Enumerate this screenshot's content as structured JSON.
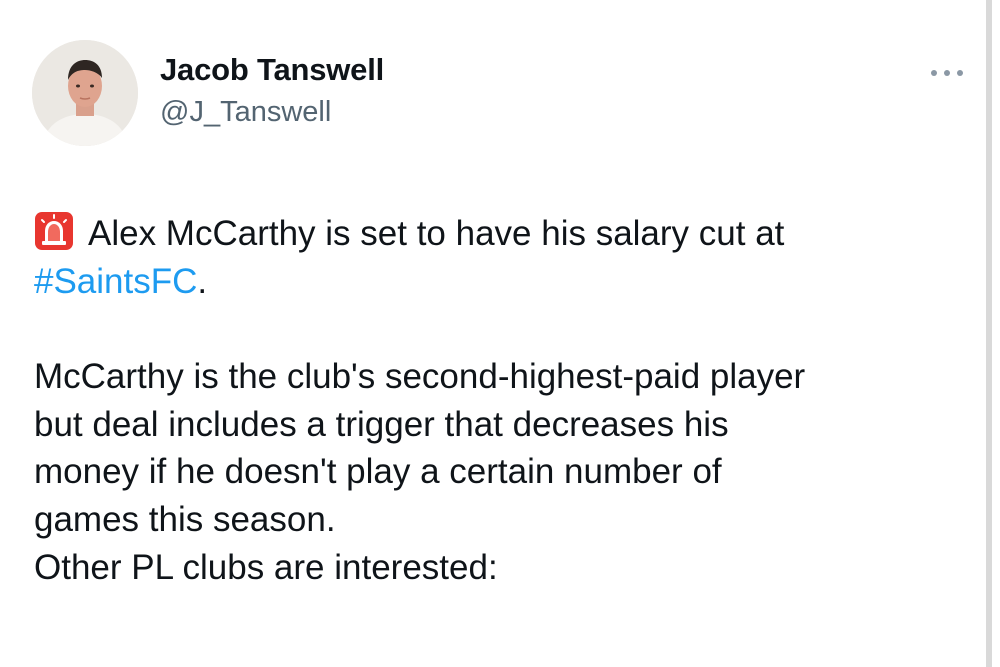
{
  "author": {
    "display_name": "Jacob Tanswell",
    "handle": "@J_Tanswell",
    "avatar_icon": "person-avatar"
  },
  "more_icon": "more-dots-icon",
  "tweet": {
    "alert_icon": "rotating-light-icon",
    "line1_text": "Alex McCarthy is set to have his salary cut at",
    "hashtag": "#SaintsFC",
    "line1_end": ".",
    "para2": [
      "McCarthy is the club's second-highest-paid player",
      "but deal includes a trigger that decreases his",
      "money if he doesn't play a certain number of",
      "games this season."
    ],
    "para3": "Other PL clubs are interested:"
  },
  "colors": {
    "text": "#0f1419",
    "secondary_text": "#536471",
    "link": "#1d9bf0",
    "alert_red": "#e8362f"
  }
}
